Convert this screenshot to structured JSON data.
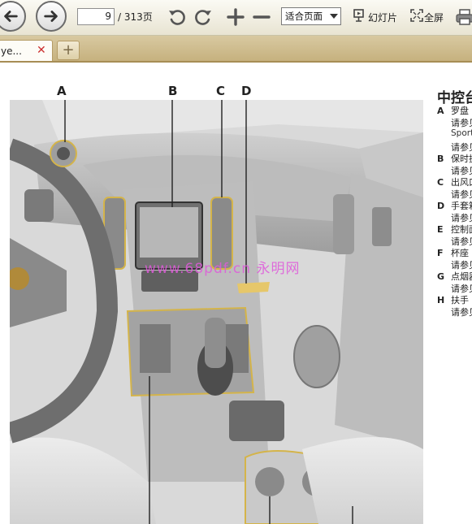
{
  "toolbar": {
    "back_icon": "back-arrow-icon",
    "forward_icon": "forward-arrow-icon",
    "current_page": "9",
    "page_total": "/ 313页",
    "zoom_value": "适合页面",
    "slideshow_label": "幻灯片",
    "fullscreen_label": "全屏"
  },
  "tabs": {
    "active_label": "ye...",
    "close_glyph": "✕",
    "new_tab_glyph": "+"
  },
  "document": {
    "callouts": [
      "A",
      "B",
      "C",
      "D"
    ],
    "legend_title": "中控台",
    "legend": [
      {
        "letter": "A",
        "label": "罗盘"
      },
      {
        "letter": "",
        "label": "请参见"
      },
      {
        "letter": "",
        "label": "Sport"
      },
      {
        "letter": "",
        "label": "请参见"
      },
      {
        "letter": "B",
        "label": "保时捷"
      },
      {
        "letter": "",
        "label": "请参见"
      },
      {
        "letter": "C",
        "label": "出风口"
      },
      {
        "letter": "",
        "label": "请参见"
      },
      {
        "letter": "D",
        "label": "手套箱"
      },
      {
        "letter": "",
        "label": "请参见"
      },
      {
        "letter": "E",
        "label": "控制面"
      },
      {
        "letter": "",
        "label": "请参见"
      },
      {
        "letter": "F",
        "label": "杯座"
      },
      {
        "letter": "",
        "label": "请参见"
      },
      {
        "letter": "G",
        "label": "点烟器"
      },
      {
        "letter": "",
        "label": "请参见"
      },
      {
        "letter": "H",
        "label": "扶手"
      },
      {
        "letter": "",
        "label": "请参见"
      }
    ],
    "watermark": "www.68pdf.cn 永明网"
  },
  "colors": {
    "toolbar_bg": "#ece8d8",
    "tabbar_bg": "#cdb98a",
    "highlight_yellow": "#d4b44a",
    "watermark": "#e05adb"
  }
}
